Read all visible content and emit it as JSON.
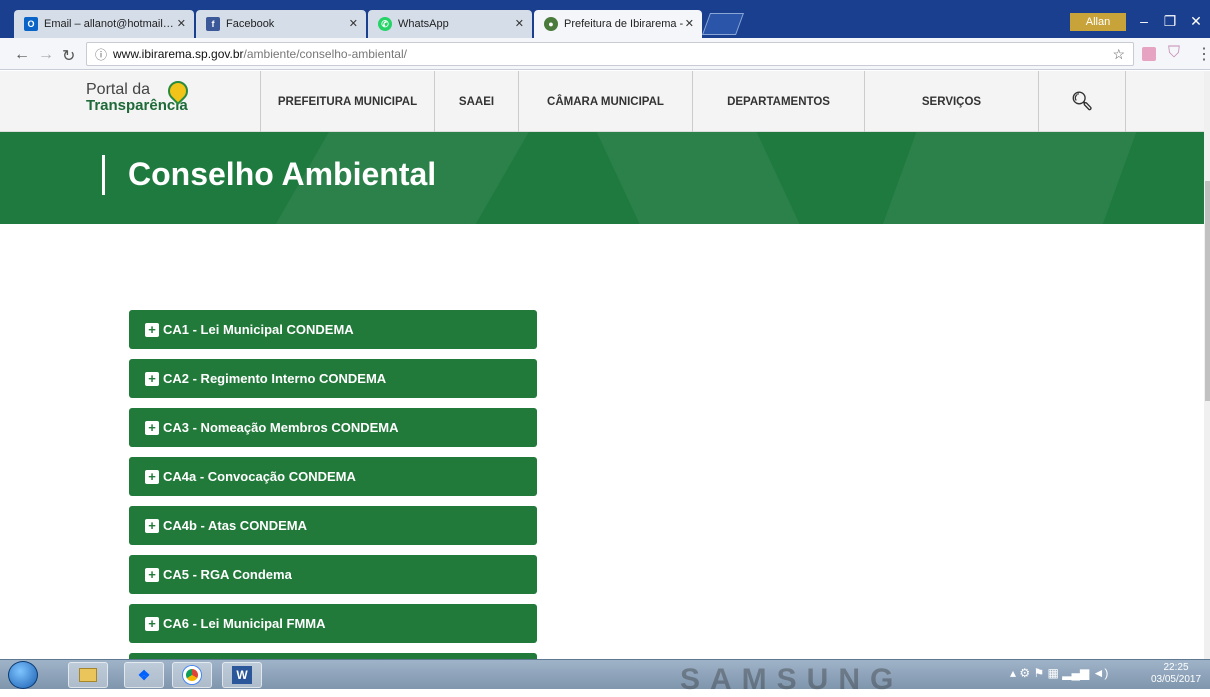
{
  "browser": {
    "tabs": [
      {
        "label": "Email – allanot@hotmail…",
        "icon": "outlook-icon",
        "color": "#0a64c8"
      },
      {
        "label": "Facebook",
        "icon": "facebook-icon",
        "color": "#3b5998"
      },
      {
        "label": "WhatsApp",
        "icon": "whatsapp-icon",
        "color": "#25d366"
      },
      {
        "label": "Prefeitura de Ibirarema - ",
        "icon": "site-icon",
        "color": "#4a7a3c"
      }
    ],
    "user": "Allan",
    "url_host": "www.ibirarema.sp.gov.br",
    "url_path": "/ambiente/conselho-ambiental/"
  },
  "site": {
    "logo_line1": "Portal da",
    "logo_line2": "Transparência",
    "nav": [
      "PREFEITURA MUNICIPAL",
      "SAAEI",
      "CÂMARA MUNICIPAL",
      "DEPARTAMENTOS",
      "SERVIÇOS"
    ],
    "page_title": "Conselho Ambiental"
  },
  "accordion": [
    "CA1 - Lei Municipal CONDEMA",
    "CA2 - Regimento Interno CONDEMA",
    "CA3 - Nomeação Membros CONDEMA",
    "CA4a - Convocação CONDEMA",
    "CA4b - Atas CONDEMA",
    "CA5 - RGA Condema",
    "CA6 - Lei Municipal FMMA"
  ],
  "taskbar": {
    "watermark": "SAMSUNG",
    "time": "22:25",
    "date": "03/05/2017"
  },
  "colors": {
    "brand_green": "#217a3a",
    "hero_green": "#1e7a3e",
    "tabbar_blue": "#1b3f8f"
  }
}
